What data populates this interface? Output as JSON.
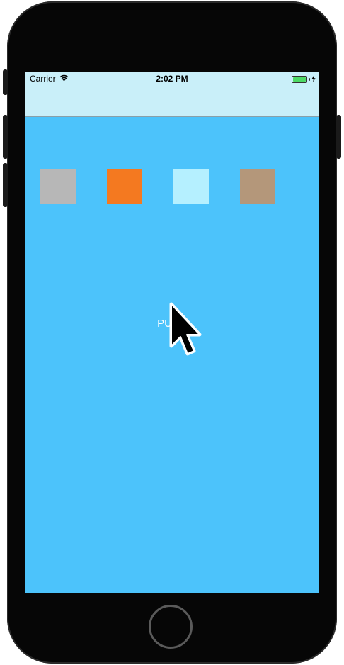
{
  "status_bar": {
    "carrier": "Carrier",
    "time": "2:02 PM",
    "wifi_icon": "wifi-icon",
    "battery_icon": "battery-icon",
    "charging_icon": "charging-bolt-icon",
    "battery_level": 1.0,
    "battery_color": "#4cd964"
  },
  "navigation_bar": {
    "title": "",
    "background": "#c9eff9"
  },
  "screen": {
    "background": "#4cc3fb"
  },
  "swatches": [
    {
      "color": "#b7b7b7"
    },
    {
      "color": "#f47920"
    },
    {
      "color": "#b5f0ff"
    },
    {
      "color": "#b4977a"
    }
  ],
  "main": {
    "push_label": "PUSH"
  },
  "pointer": {
    "icon": "mouse-cursor-icon"
  },
  "device": {
    "frame_color": "#060606",
    "home_button_icon": "home-button-icon"
  }
}
